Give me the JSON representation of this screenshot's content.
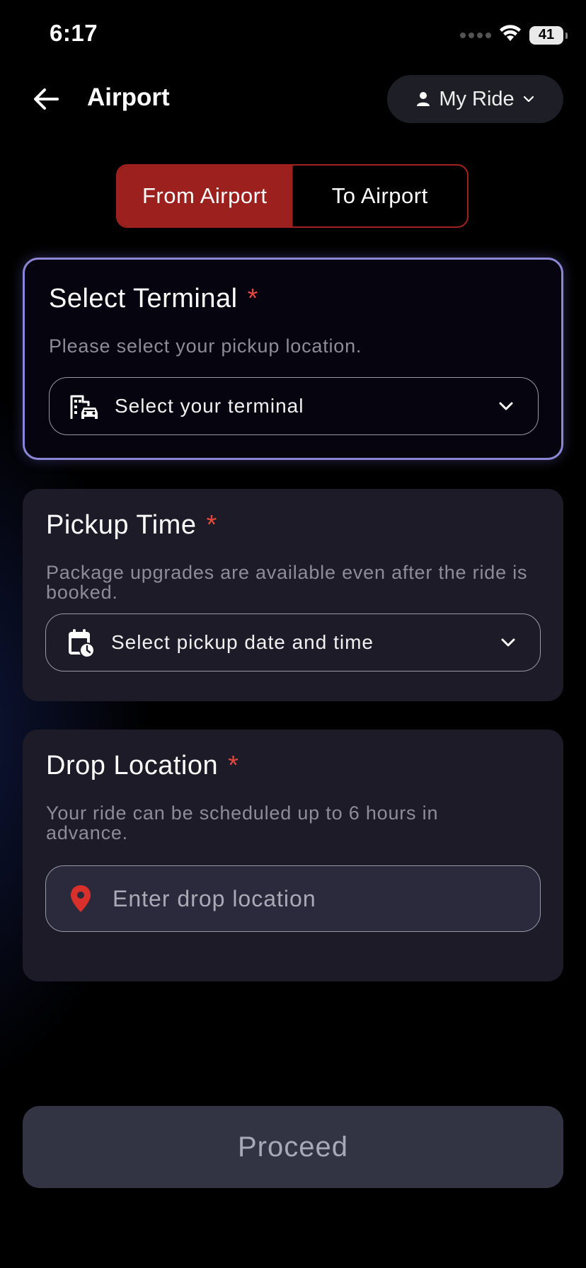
{
  "status_bar": {
    "time": "6:17",
    "battery": "41"
  },
  "header": {
    "title": "Airport",
    "my_ride_label": "My Ride"
  },
  "toggle": {
    "from_airport": "From Airport",
    "to_airport": "To Airport",
    "selected": "From Airport"
  },
  "terminal_card": {
    "title": "Select Terminal",
    "required_mark": "*",
    "description": "Please select your pickup location.",
    "field_text": "Select your terminal"
  },
  "pickup_card": {
    "title": "Pickup Time",
    "required_mark": "*",
    "description": "Package upgrades are available even after the ride is booked.",
    "field_text": "Select pickup date and time"
  },
  "drop_card": {
    "title": "Drop Location",
    "required_mark": "*",
    "description": "Your ride can be scheduled up to 6 hours in advance.",
    "placeholder": "Enter drop location",
    "value": ""
  },
  "proceed_label": "Proceed",
  "colors": {
    "accent_red": "#9b201e",
    "required_star": "#e5483e",
    "highlight_border": "#8b86d6",
    "card_bg": "#1c1b27",
    "proceed_bg": "#323444"
  },
  "icons": {
    "back": "arrow-left-icon",
    "user": "person-icon",
    "dropdown": "chevron-down-icon",
    "terminal": "building-car-icon",
    "calendar": "calendar-clock-icon",
    "location": "map-pin-icon",
    "wifi": "wifi-icon",
    "signal": "signal-dots-icon",
    "battery": "battery-icon"
  }
}
